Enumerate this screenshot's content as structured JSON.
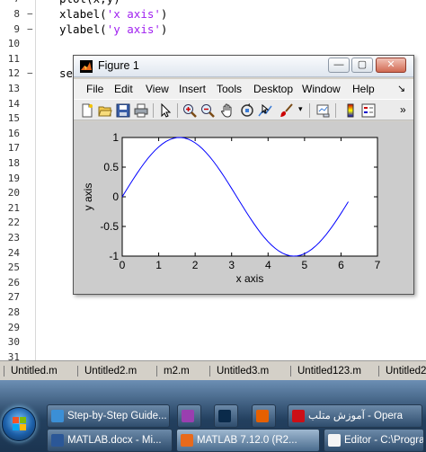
{
  "editor": {
    "lines": [
      {
        "n": "8",
        "fold": "−",
        "pre": "xlabel(",
        "str": "'x axis'",
        "post": ")"
      },
      {
        "n": "9",
        "fold": "−",
        "pre": "ylabel(",
        "str": "'y axis'",
        "post": ")"
      },
      {
        "n": "10",
        "fold": "",
        "pre": "",
        "str": "",
        "post": ""
      },
      {
        "n": "11",
        "fold": "",
        "pre": "",
        "str": "",
        "post": ""
      },
      {
        "n": "12",
        "fold": "−",
        "pre": "se",
        "str": "",
        "post": ""
      },
      {
        "n": "13",
        "fold": "",
        "pre": "",
        "str": "",
        "post": ""
      },
      {
        "n": "14",
        "fold": "",
        "pre": "",
        "str": "",
        "post": ""
      },
      {
        "n": "15",
        "fold": "",
        "pre": "",
        "str": "",
        "post": ""
      },
      {
        "n": "16",
        "fold": "",
        "pre": "",
        "str": "",
        "post": ""
      },
      {
        "n": "17",
        "fold": "",
        "pre": "",
        "str": "",
        "post": ""
      },
      {
        "n": "18",
        "fold": "",
        "pre": "",
        "str": "",
        "post": ""
      },
      {
        "n": "19",
        "fold": "",
        "pre": "",
        "str": "",
        "post": ""
      },
      {
        "n": "20",
        "fold": "",
        "pre": "",
        "str": "",
        "post": ""
      },
      {
        "n": "21",
        "fold": "",
        "pre": "",
        "str": "",
        "post": ""
      },
      {
        "n": "22",
        "fold": "",
        "pre": "",
        "str": "",
        "post": ""
      },
      {
        "n": "23",
        "fold": "",
        "pre": "",
        "str": "",
        "post": ""
      },
      {
        "n": "24",
        "fold": "",
        "pre": "",
        "str": "",
        "post": ""
      },
      {
        "n": "25",
        "fold": "",
        "pre": "",
        "str": "",
        "post": ""
      },
      {
        "n": "26",
        "fold": "",
        "pre": "",
        "str": "",
        "post": ""
      },
      {
        "n": "27",
        "fold": "",
        "pre": "",
        "str": "",
        "post": ""
      },
      {
        "n": "28",
        "fold": "",
        "pre": "",
        "str": "",
        "post": ""
      },
      {
        "n": "29",
        "fold": "",
        "pre": "",
        "str": "",
        "post": ""
      },
      {
        "n": "30",
        "fold": "",
        "pre": "",
        "str": "",
        "post": ""
      },
      {
        "n": "31",
        "fold": "",
        "pre": "",
        "str": "",
        "post": ""
      }
    ],
    "top_partial": {
      "n": "7",
      "text": "plot(x,y)"
    }
  },
  "tabs": [
    "Untitled.m",
    "Untitled2.m",
    "m2.m",
    "Untitled3.m",
    "Untitled123.m",
    "Untitled2"
  ],
  "figure": {
    "title": "Figure 1",
    "menu": [
      "File",
      "Edit",
      "View",
      "Insert",
      "Tools",
      "Desktop",
      "Window",
      "Help"
    ],
    "menu_overflow": "↘",
    "toolbar_overflow": "»",
    "icons": [
      "new-figure-icon",
      "open-file-icon",
      "save-icon",
      "print-icon",
      "edit-plot-icon",
      "zoom-in-icon",
      "zoom-out-icon",
      "pan-icon",
      "rotate-3d-icon",
      "data-cursor-icon",
      "brush-icon",
      "link-plot-icon",
      "colorbar-icon",
      "legend-icon"
    ],
    "window_buttons": {
      "minimize": "—",
      "maximize": "▢",
      "close": "✕"
    }
  },
  "chart_data": {
    "type": "line",
    "title": "",
    "xlabel": "x axis",
    "ylabel": "y axis",
    "xlim": [
      0,
      7
    ],
    "ylim": [
      -1,
      1
    ],
    "xticks": [
      "0",
      "1",
      "2",
      "3",
      "4",
      "5",
      "6",
      "7"
    ],
    "yticks": [
      "-1",
      "-0.5",
      "0",
      "0.5",
      "1"
    ],
    "grid": false,
    "series": [
      {
        "color": "#0000ff",
        "x": [
          0,
          0.1,
          0.2,
          0.3,
          0.4,
          0.5,
          0.6,
          0.7,
          0.8,
          0.9,
          1.0,
          1.1,
          1.2,
          1.3,
          1.4,
          1.5,
          1.6,
          1.7,
          1.8,
          1.9,
          2.0,
          2.1,
          2.2,
          2.3,
          2.4,
          2.5,
          2.6,
          2.7,
          2.8,
          2.9,
          3.0,
          3.1,
          3.2,
          3.3,
          3.4,
          3.5,
          3.6,
          3.7,
          3.8,
          3.9,
          4.0,
          4.1,
          4.2,
          4.3,
          4.4,
          4.5,
          4.6,
          4.7,
          4.8,
          4.9,
          5.0,
          5.1,
          5.2,
          5.3,
          5.4,
          5.5,
          5.6,
          5.7,
          5.8,
          5.9,
          6.0,
          6.1,
          6.2
        ],
        "y": [
          0,
          0.0998,
          0.1987,
          0.2955,
          0.3894,
          0.4794,
          0.5646,
          0.6442,
          0.7174,
          0.7833,
          0.8415,
          0.8912,
          0.932,
          0.9636,
          0.9854,
          0.9975,
          0.9996,
          0.9917,
          0.9738,
          0.9463,
          0.9093,
          0.8632,
          0.8085,
          0.7457,
          0.6755,
          0.5985,
          0.5155,
          0.4274,
          0.335,
          0.2392,
          0.1411,
          0.0416,
          -0.0584,
          -0.1577,
          -0.2555,
          -0.3508,
          -0.4425,
          -0.5298,
          -0.6119,
          -0.6878,
          -0.7568,
          -0.8183,
          -0.8716,
          -0.9162,
          -0.9516,
          -0.9775,
          -0.9937,
          -0.9999,
          -0.9962,
          -0.9825,
          -0.9589,
          -0.9258,
          -0.8835,
          -0.8323,
          -0.7728,
          -0.7055,
          -0.6313,
          -0.5507,
          -0.4646,
          -0.3739,
          -0.2794,
          -0.1822,
          -0.0831
        ]
      }
    ]
  },
  "taskbar": {
    "row1": [
      {
        "label": "Step-by-Step Guide...",
        "icon": "ie-icon"
      },
      {
        "label": "",
        "icon": "onenote-icon"
      },
      {
        "label": "",
        "icon": "photoshop-icon"
      },
      {
        "label": "",
        "icon": "firefox-icon"
      },
      {
        "label": "آموزش متلب - Opera",
        "icon": "opera-icon"
      }
    ],
    "row2": [
      {
        "label": "MATLAB.docx - Mi...",
        "icon": "word-icon"
      },
      {
        "label": "MATLAB  7.12.0 (R2...",
        "icon": "matlab-icon"
      },
      {
        "label": "Editor - C:\\Program ...",
        "icon": "editor-icon"
      }
    ],
    "colors": {
      "brand_blue": "#1c5fa8",
      "plot_line": "#0000ff",
      "string_purple": "#a020f0"
    }
  }
}
